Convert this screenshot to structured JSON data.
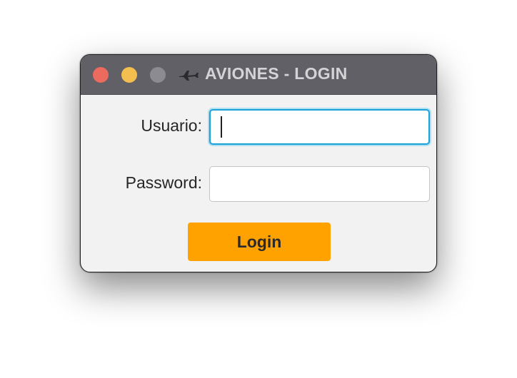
{
  "window": {
    "title": "AVIONES - LOGIN",
    "icon": "airplane-icon",
    "traffic_lights": {
      "close_color": "#ed6a5e",
      "minimize_color": "#f5bf4f",
      "zoom_color": "#8c8c90"
    }
  },
  "form": {
    "username_label": "Usuario:",
    "username_value": "",
    "password_label": "Password:",
    "password_value": ""
  },
  "login_button": {
    "label": "Login",
    "color": "#ffa200"
  }
}
